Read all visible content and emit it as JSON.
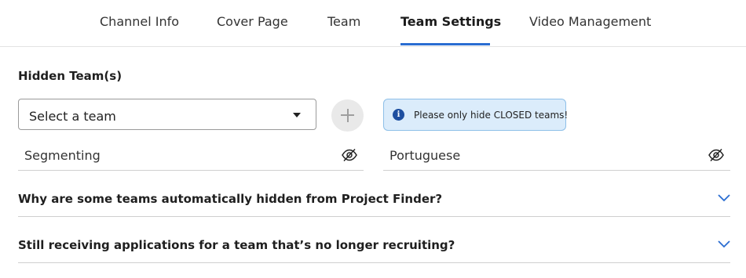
{
  "tabs": [
    {
      "label": "Channel Info",
      "active": false
    },
    {
      "label": "Cover Page",
      "active": false
    },
    {
      "label": "Team",
      "active": false
    },
    {
      "label": "Team Settings",
      "active": true
    },
    {
      "label": "Video Management",
      "active": false
    }
  ],
  "hidden_teams": {
    "title": "Hidden Team(s)",
    "select_value": "Select a team",
    "add_icon": "plus-icon",
    "notice": {
      "icon": "info-icon",
      "icon_glyph": "i",
      "text": "Please only hide CLOSED teams!"
    },
    "teams": [
      {
        "name": "Segmenting",
        "icon": "eye-slash-icon"
      },
      {
        "name": "Portuguese",
        "icon": "eye-slash-icon"
      }
    ]
  },
  "faqs": [
    {
      "question": "Why are some teams automatically hidden from Project Finder?",
      "icon": "chevron-down-icon"
    },
    {
      "question": "Still receiving applications for a team that’s no longer recruiting?",
      "icon": "chevron-down-icon"
    }
  ],
  "colors": {
    "accent": "#2a6dd1",
    "notice_bg": "#dbecfb",
    "notice_border": "#8dbfe8",
    "info_icon": "#1e4fa0"
  }
}
